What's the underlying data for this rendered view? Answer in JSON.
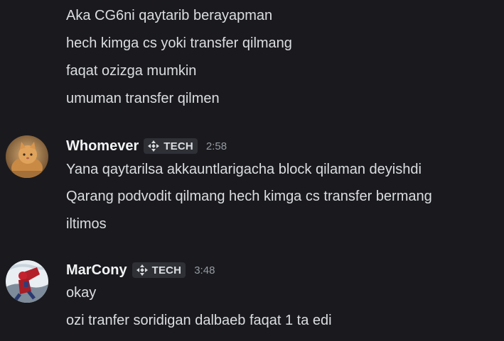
{
  "messages_top": {
    "lines": [
      "Aka CG6ni qaytarib berayapman",
      "hech kimga cs yoki transfer qilmang",
      "faqat ozizga mumkin",
      "umuman transfer qilmen"
    ]
  },
  "message_whomever": {
    "username": "Whomever",
    "tag": "TECH",
    "time": "2:58",
    "lines": [
      "Yana qaytarilsa akkauntlarigacha block qilaman deyishdi",
      "Qarang podvodit qilmang hech kimga cs transfer bermang",
      "iltimos"
    ]
  },
  "message_marcony": {
    "username": "MarCony",
    "tag": "TECH",
    "time": "3:48",
    "lines": [
      "okay",
      "ozi tranfer soridigan dalbaeb faqat 1 ta edi"
    ]
  },
  "icons": {
    "tag_icon": "move-arrows-icon",
    "avatar_whomever": "cat-avatar",
    "avatar_marcony": "hero-avatar"
  },
  "colors": {
    "background": "#1a1a1e",
    "text": "#dbdee1",
    "username": "#f2f3f5",
    "timestamp": "#949ba4",
    "tag_bg": "#2e3036"
  }
}
